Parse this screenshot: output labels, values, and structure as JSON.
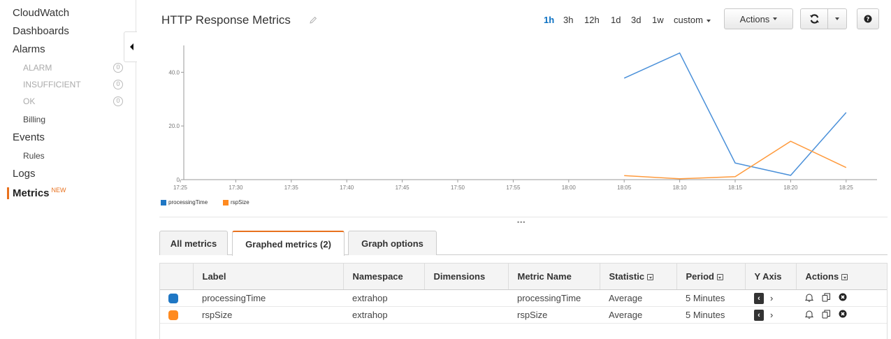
{
  "sidebar": {
    "cloudwatch": "CloudWatch",
    "dashboards": "Dashboards",
    "alarms": "Alarms",
    "alarm_states": [
      {
        "label": "ALARM",
        "count": "0"
      },
      {
        "label": "INSUFFICIENT",
        "count": "0"
      },
      {
        "label": "OK",
        "count": "0"
      }
    ],
    "billing": "Billing",
    "events": "Events",
    "rules": "Rules",
    "logs": "Logs",
    "metrics": "Metrics",
    "metrics_badge": "NEW"
  },
  "header": {
    "title": "HTTP Response Metrics",
    "time_ranges": [
      "1h",
      "3h",
      "12h",
      "1d",
      "3d",
      "1w"
    ],
    "active_range": "1h",
    "custom_label": "custom",
    "actions_label": "Actions"
  },
  "chart_data": {
    "type": "line",
    "x": [
      "17:25",
      "17:30",
      "17:35",
      "17:40",
      "17:45",
      "17:50",
      "17:55",
      "18:00",
      "18:05",
      "18:10",
      "18:15",
      "18:20",
      "18:25"
    ],
    "y_ticks": [
      "0",
      "20.0",
      "40.0"
    ],
    "ylim": [
      0,
      50
    ],
    "series": [
      {
        "name": "processingTime",
        "color": "#4a90d9",
        "values": [
          null,
          null,
          null,
          null,
          null,
          null,
          null,
          null,
          37.8,
          47.2,
          6.2,
          1.6,
          25.0
        ]
      },
      {
        "name": "rspSize",
        "color": "#ff9a3c",
        "values": [
          null,
          null,
          null,
          null,
          null,
          null,
          null,
          null,
          1.5,
          0.3,
          1.1,
          14.3,
          4.5
        ]
      }
    ]
  },
  "tabs": [
    "All metrics",
    "Graphed metrics (2)",
    "Graph options"
  ],
  "table": {
    "columns": [
      "Label",
      "Namespace",
      "Dimensions",
      "Metric Name",
      "Statistic",
      "Period",
      "Y Axis",
      "Actions"
    ],
    "rows": [
      {
        "color": "#1f77c4",
        "label": "processingTime",
        "namespace": "extrahop",
        "dimensions": "",
        "metric": "processingTime",
        "statistic": "Average",
        "period": "5 Minutes"
      },
      {
        "color": "#ff8a1f",
        "label": "rspSize",
        "namespace": "extrahop",
        "dimensions": "",
        "metric": "rspSize",
        "statistic": "Average",
        "period": "5 Minutes"
      }
    ]
  }
}
